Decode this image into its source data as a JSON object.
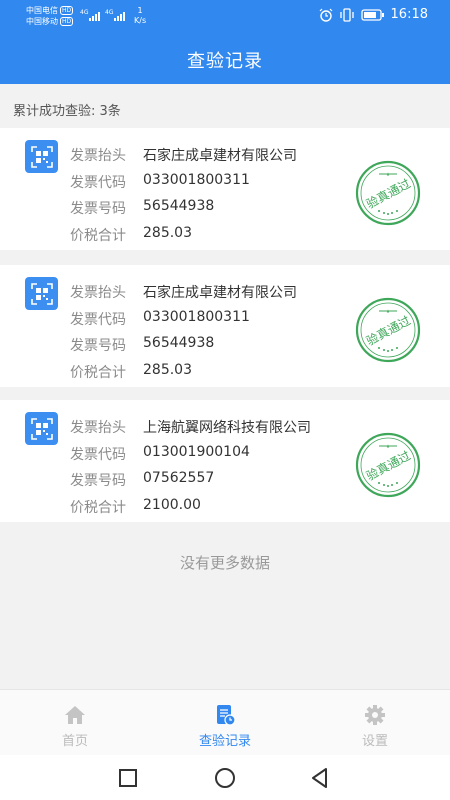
{
  "status_bar": {
    "carrier1": "中国电信",
    "carrier2": "中国移动",
    "hd_badge": "HD",
    "net_type": "4G",
    "speed_value": "1",
    "speed_unit": "K/s",
    "time": "16:18"
  },
  "header": {
    "title": "查验记录"
  },
  "summary": "累计成功查验: 3条",
  "field_labels": {
    "title": "发票抬头",
    "code": "发票代码",
    "number": "发票号码",
    "total": "价税合计"
  },
  "records": [
    {
      "title": "石家庄成卓建材有限公司",
      "code": "033001800311",
      "number": "56544938",
      "total": "285.03",
      "stamp_text": "验真通过"
    },
    {
      "title": "石家庄成卓建材有限公司",
      "code": "033001800311",
      "number": "56544938",
      "total": "285.03",
      "stamp_text": "验真通过"
    },
    {
      "title": "上海航翼网络科技有限公司",
      "code": "013001900104",
      "number": "07562557",
      "total": "2100.00",
      "stamp_text": "验真通过"
    }
  ],
  "no_more": "没有更多数据",
  "tabs": [
    {
      "label": "首页",
      "icon": "home-icon",
      "active": false
    },
    {
      "label": "查验记录",
      "icon": "records-icon",
      "active": true
    },
    {
      "label": "设置",
      "icon": "gear-icon",
      "active": false
    }
  ],
  "colors": {
    "primary": "#3189f0",
    "stamp": "#3fa75a"
  }
}
